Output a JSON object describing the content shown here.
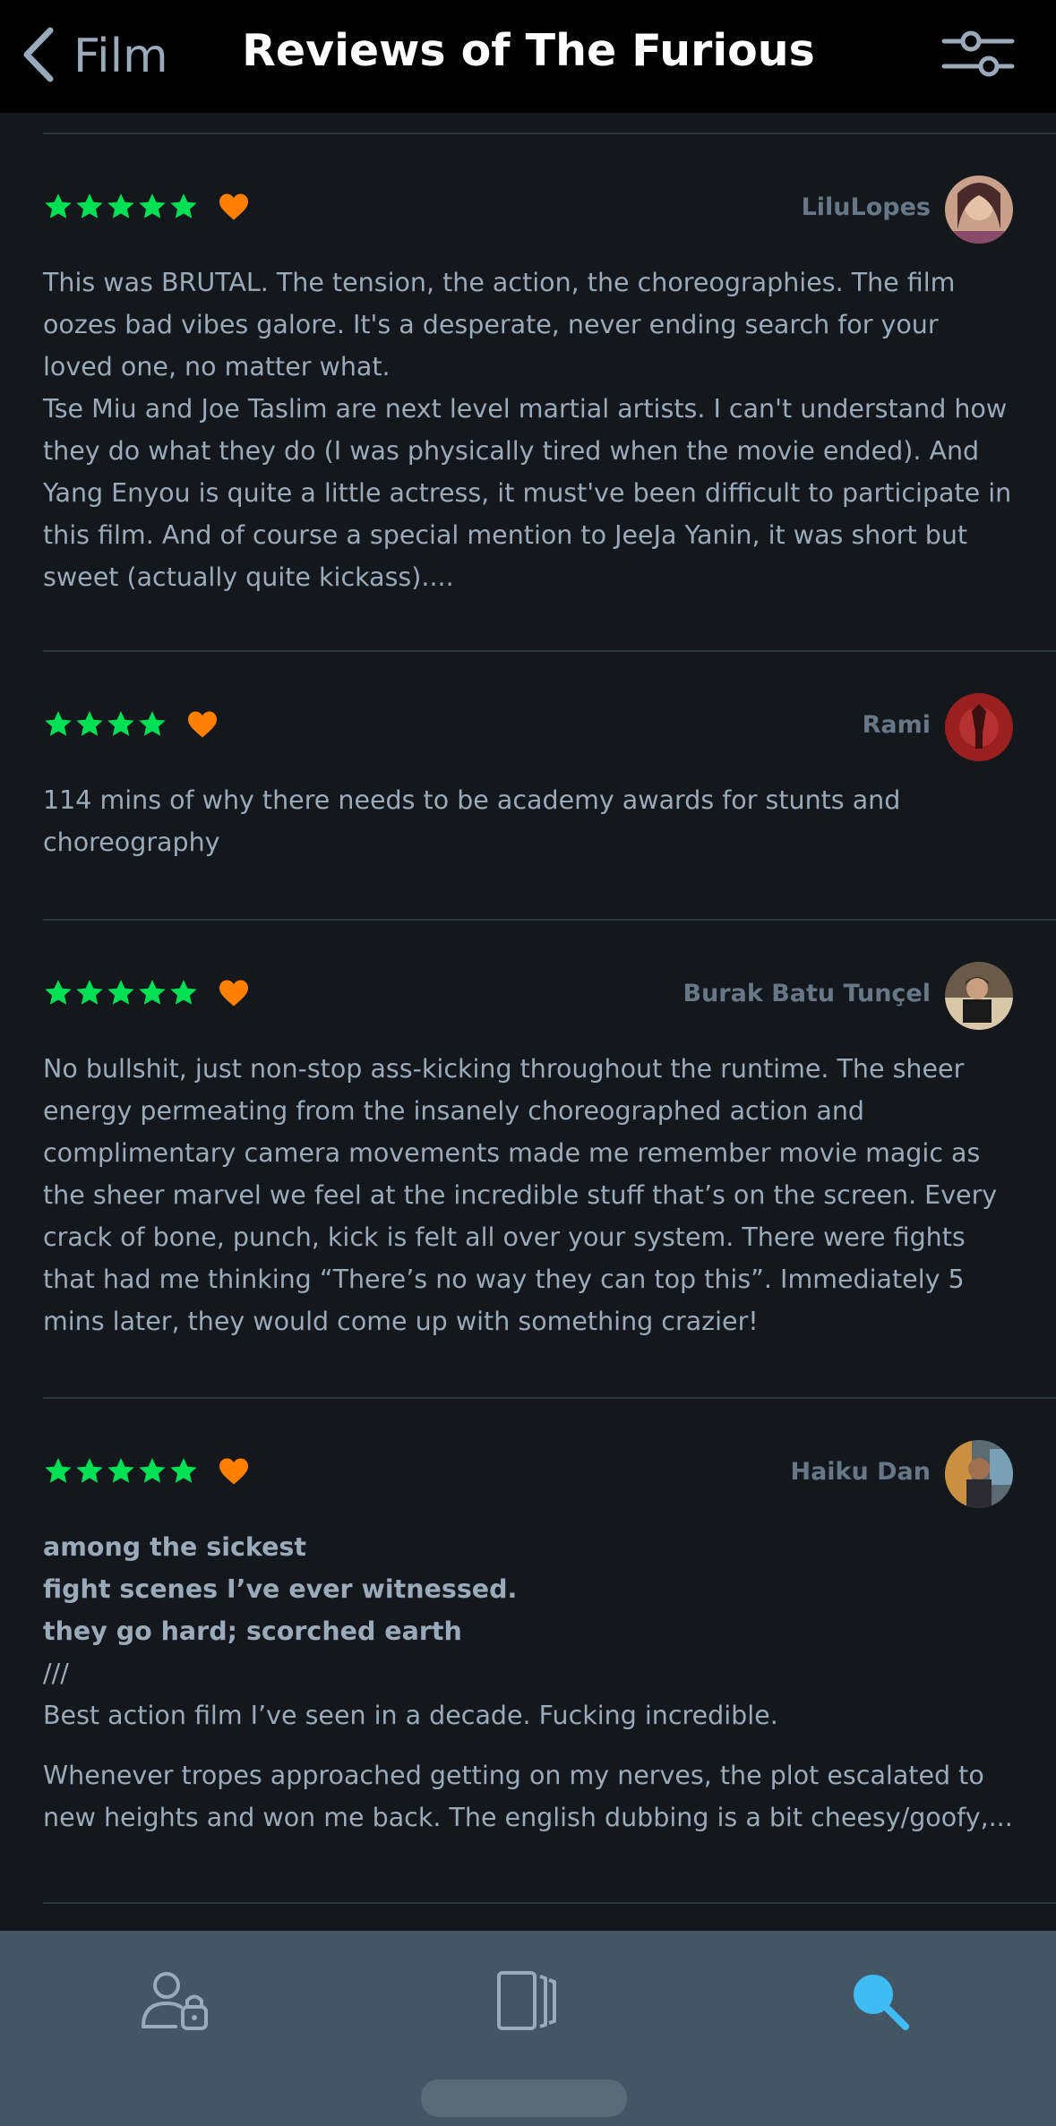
{
  "header": {
    "back_label": "Film",
    "title": "Reviews of The Furious",
    "back_icon": "chevron-left-icon",
    "filter_icon": "sliders-icon"
  },
  "colors": {
    "star": "#00e054",
    "heart": "#ff8000",
    "text": "#99aabb",
    "author": "#667788",
    "search_active": "#40bcf4"
  },
  "reviews": [
    {
      "author": "LiluLopes",
      "rating": 5,
      "liked": true,
      "paragraphs": [
        "This was BRUTAL. The tension, the action, the choreographies. The film oozes bad vibes galore. It's a desperate, never ending search for your loved one, no matter what.",
        "Tse Miu and Joe Taslim are next level martial artists. I can't understand how they do what they do (I was physically tired when the movie ended). And Yang Enyou is quite a little actress, it must've been difficult to participate in this film. And of course a special mention to JeeJa Yanin, it was short but sweet (actually quite kickass)...."
      ]
    },
    {
      "author": "Rami",
      "rating": 4,
      "liked": true,
      "paragraphs": [
        "114 mins of why there needs to be academy awards for stunts and choreography"
      ]
    },
    {
      "author": "Burak Batu Tunçel",
      "rating": 5,
      "liked": true,
      "paragraphs": [
        "No bullshit, just non-stop ass-kicking throughout the runtime. The sheer energy permeating from the insanely choreographed action and complimentary camera movements made me remember movie magic as the sheer marvel we feel at the incredible stuff that’s on the screen. Every crack of bone, punch, kick is felt all over your system. There were fights that had me thinking “There’s no way they can top this”. Immediately 5 mins later, they would come up with something crazier!"
      ]
    },
    {
      "author": "Haiku Dan",
      "rating": 5,
      "liked": true,
      "bold_lines": [
        "among the sickest",
        "fight scenes I’ve ever witnessed.",
        "they go hard; scorched earth"
      ],
      "separator": "///",
      "line": "Best action film I’ve seen in a decade. Fucking incredible.",
      "paragraph": "Whenever tropes approached getting on my nerves, the plot escalated to new heights and won me back. The english dubbing is a bit cheesy/goofy,..."
    }
  ],
  "tabbar": {
    "tabs": [
      {
        "name": "profile",
        "icon": "profile-lock-icon"
      },
      {
        "name": "activity",
        "icon": "cards-icon"
      },
      {
        "name": "search",
        "icon": "search-icon",
        "active": true
      }
    ]
  }
}
